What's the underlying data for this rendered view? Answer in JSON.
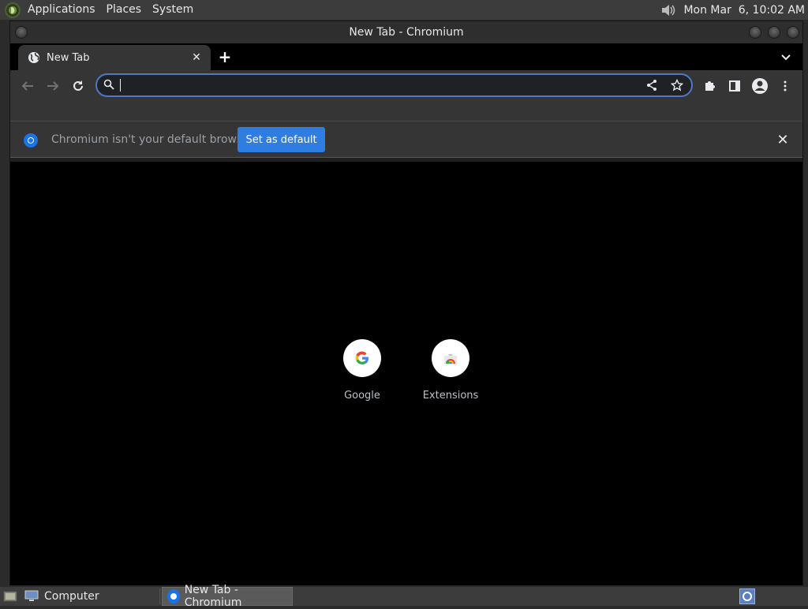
{
  "top_panel": {
    "menus": [
      "Applications",
      "Places",
      "System"
    ],
    "clock": "Mon Mar  6, 10:02 AM"
  },
  "window": {
    "title": "New Tab - Chromium"
  },
  "tab": {
    "title": "New Tab"
  },
  "omnibox": {
    "value": "",
    "placeholder": ""
  },
  "infobar": {
    "message": "Chromium isn't your default browser",
    "button": "Set as default"
  },
  "shortcuts": [
    {
      "label": "Google",
      "icon": "google-g-icon"
    },
    {
      "label": "Extensions",
      "icon": "chrome-web-store-icon"
    }
  ],
  "taskbar": {
    "items": [
      {
        "label": "Computer",
        "icon": "computer-icon"
      },
      {
        "label": "New Tab - Chromium",
        "icon": "chromium-icon"
      }
    ]
  },
  "colors": {
    "accent": "#2f7de1",
    "omnibox_focus": "#4d79c9",
    "content_bg": "#000000",
    "chrome_bg": "#353535"
  }
}
